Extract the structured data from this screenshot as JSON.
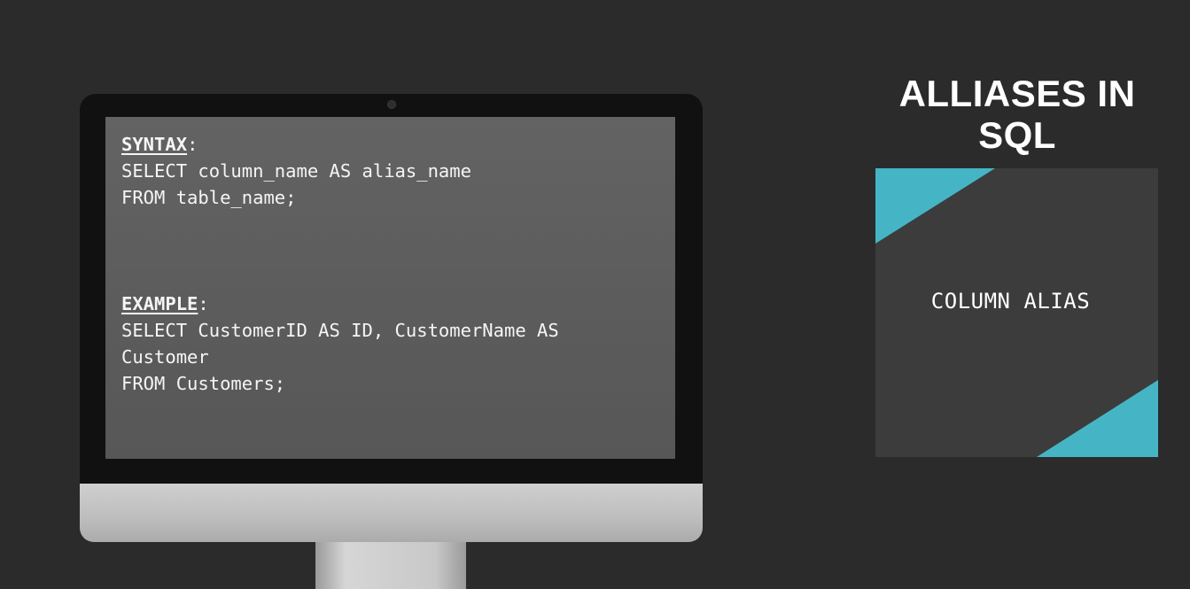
{
  "screen": {
    "syntax_heading": "SYNTAX",
    "syntax_colon": ":",
    "syntax_lines": [
      "SELECT column_name AS alias_name",
      "FROM table_name;"
    ],
    "example_heading": "EXAMPLE",
    "example_colon": ":",
    "example_lines": [
      "SELECT CustomerID AS ID, CustomerName AS",
      "Customer",
      "FROM Customers;"
    ]
  },
  "title": {
    "line1": "ALLIASES IN",
    "line2": "SQL"
  },
  "card": {
    "label": "COLUMN ALIAS",
    "accent_color": "#45b5c6"
  }
}
